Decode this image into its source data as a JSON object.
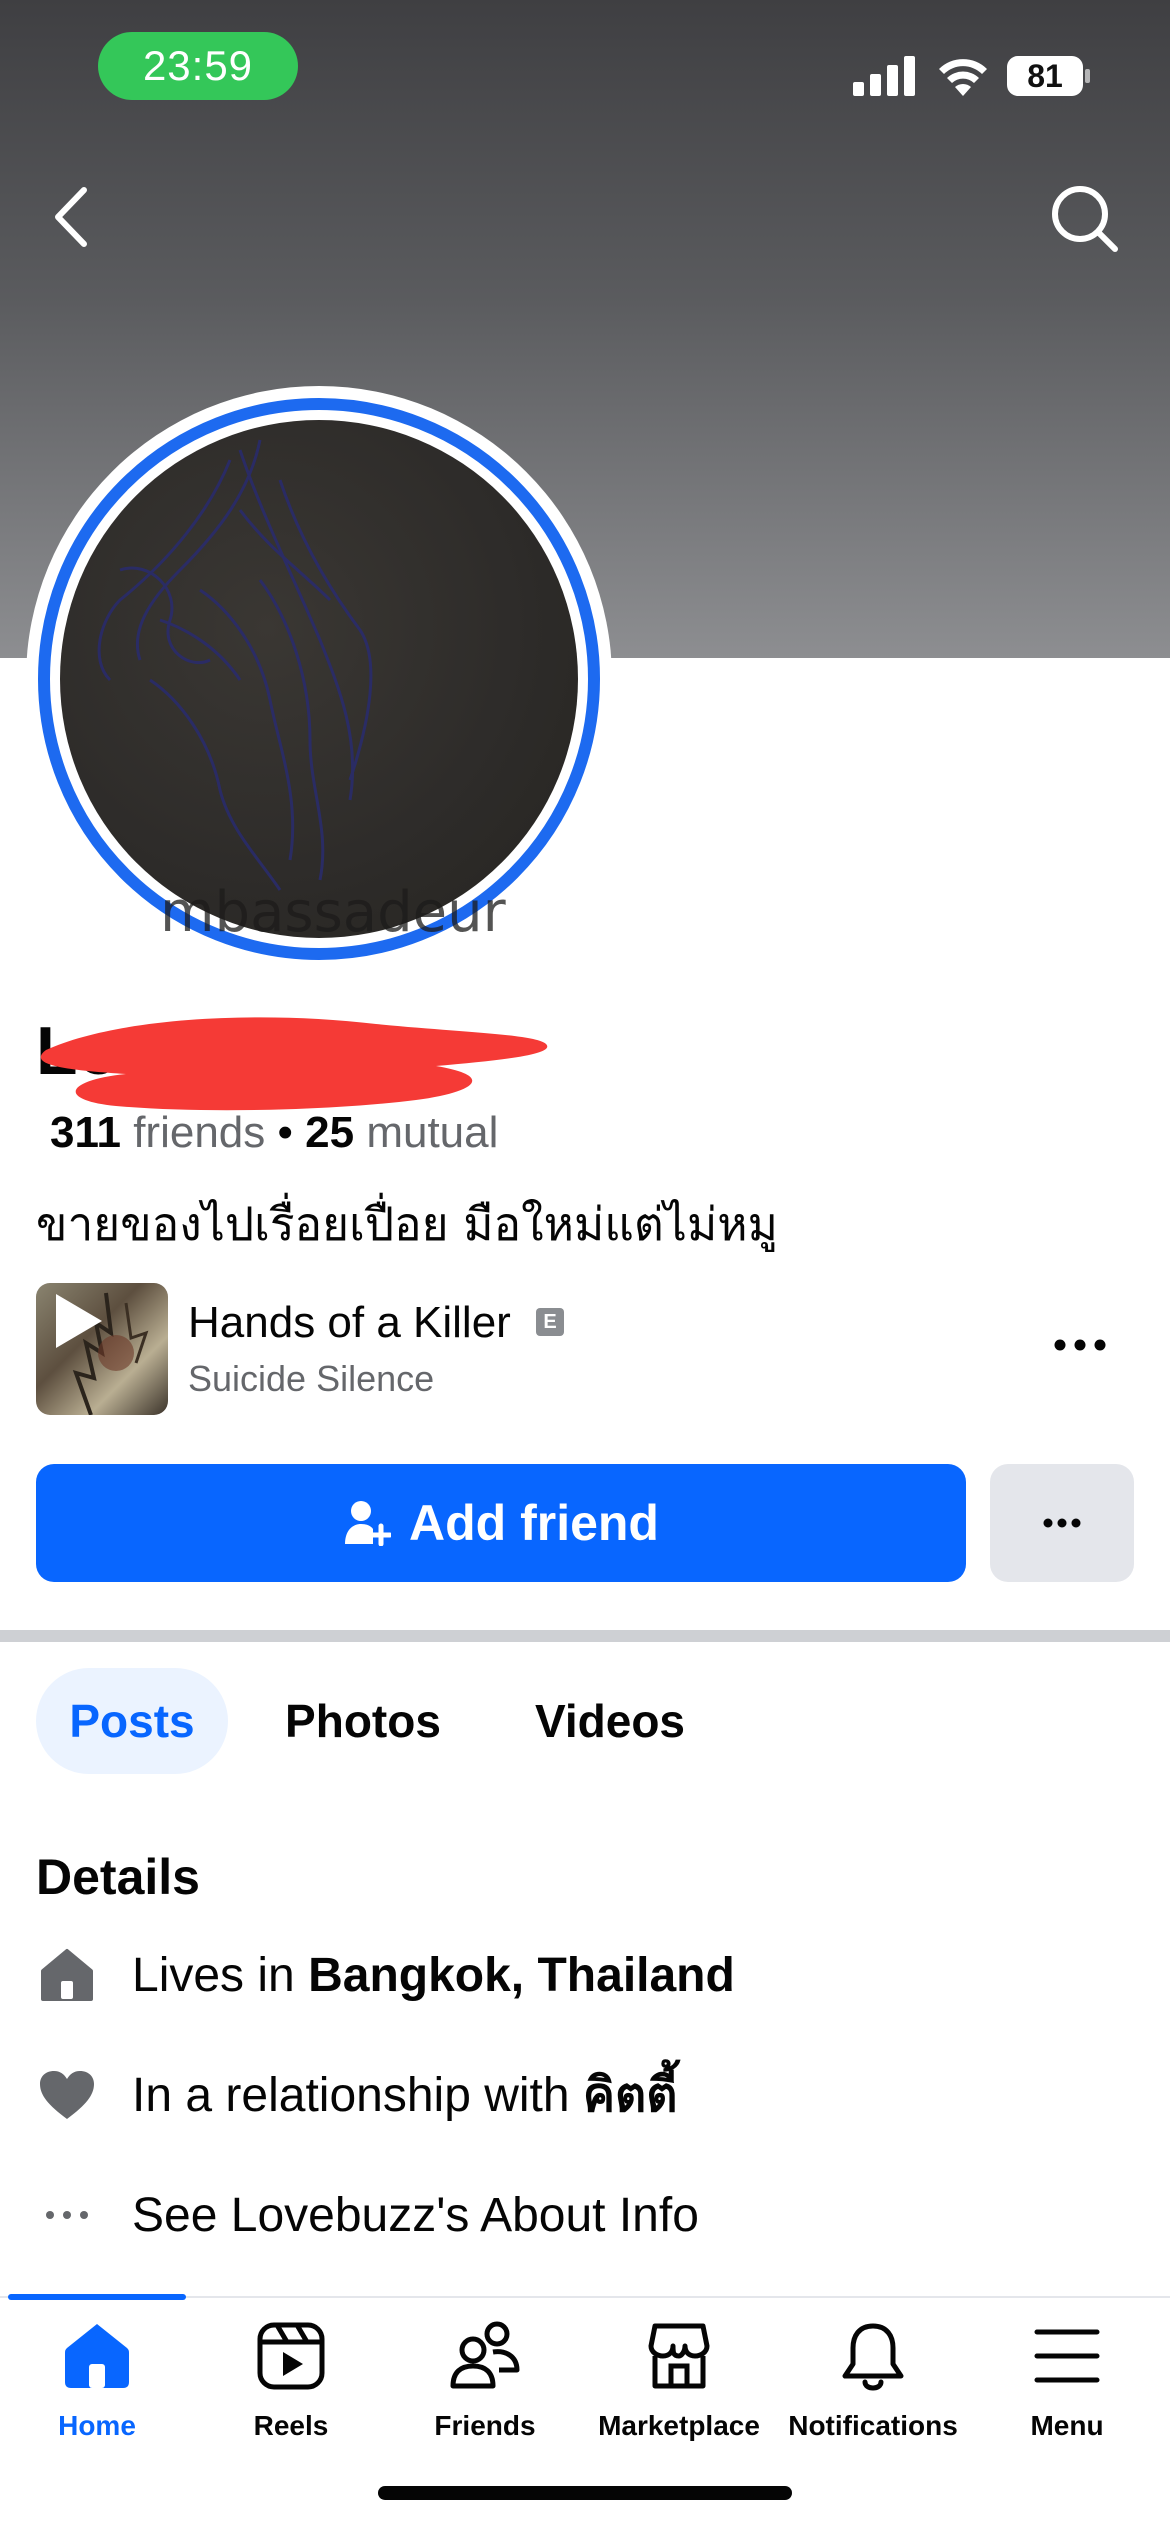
{
  "status_bar": {
    "time": "23:59",
    "battery": "81"
  },
  "profile": {
    "name": "Lovebuzz",
    "avatar_watermark": "mbassadeur",
    "friends_count": "311",
    "friends_label": " friends",
    "separator": " • ",
    "mutual_count": "25",
    "mutual_label": " mutual",
    "bio": "ขายของไปเรื่อยเปื่อย มือใหม่แต่ไม่หมู"
  },
  "music": {
    "title": "Hands of a Killer",
    "explicit_badge": "E",
    "artist": "Suicide Silence"
  },
  "actions": {
    "add_friend_label": "Add friend"
  },
  "tabs": [
    {
      "label": "Posts",
      "active": true
    },
    {
      "label": "Photos",
      "active": false
    },
    {
      "label": "Videos",
      "active": false
    }
  ],
  "details": {
    "title": "Details",
    "lives_prefix": "Lives in ",
    "lives_place": "Bangkok, Thailand",
    "relationship_prefix": "In a relationship with ",
    "relationship_partner": "คิตตี้",
    "about_link": "See Lovebuzz's About Info"
  },
  "bottom_nav": [
    {
      "label": "Home",
      "icon": "home-icon",
      "active": true
    },
    {
      "label": "Reels",
      "icon": "reels-icon",
      "active": false
    },
    {
      "label": "Friends",
      "icon": "friends-icon",
      "active": false
    },
    {
      "label": "Marketplace",
      "icon": "marketplace-icon",
      "active": false
    },
    {
      "label": "Notifications",
      "icon": "bell-icon",
      "active": false
    },
    {
      "label": "Menu",
      "icon": "menu-icon",
      "active": false
    }
  ],
  "colors": {
    "accent": "#0866ff",
    "status_green": "#34c759",
    "ring_blue": "#1d6af0",
    "redaction": "#f53a36"
  }
}
